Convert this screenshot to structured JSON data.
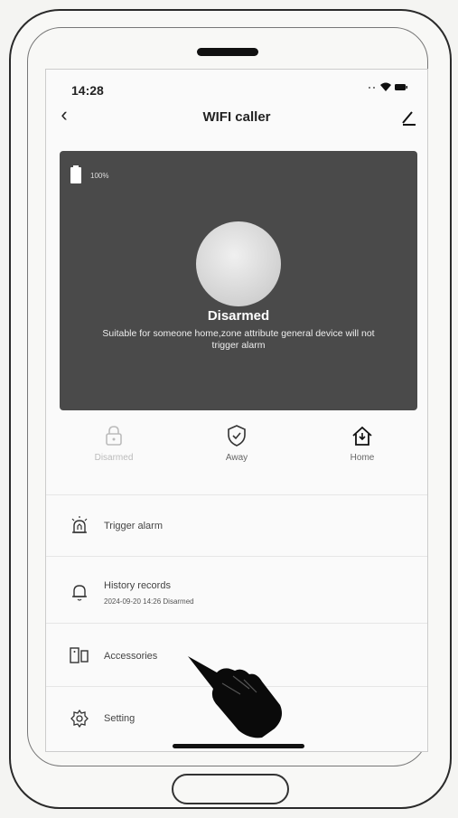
{
  "status": {
    "time": "14:28"
  },
  "header": {
    "title": "WIFI caller"
  },
  "hero": {
    "battery_pct": "100%",
    "state": "Disarmed",
    "description": "Suitable for someone home,zone attribute general device will not trigger alarm"
  },
  "modes": [
    {
      "label": "Disarmed",
      "icon": "lock-icon"
    },
    {
      "label": "Away",
      "icon": "shield-check-icon"
    },
    {
      "label": "Home",
      "icon": "home-icon"
    }
  ],
  "menu": {
    "trigger": {
      "label": "Trigger alarm",
      "icon": "alarm-siren-icon"
    },
    "history": {
      "label": "History records",
      "sub": "2024-09-20 14:26 Disarmed",
      "icon": "bell-icon"
    },
    "accessories": {
      "label": "Accessories",
      "icon": "device-icon"
    },
    "setting": {
      "label": "Setting",
      "icon": "gear-icon"
    }
  }
}
